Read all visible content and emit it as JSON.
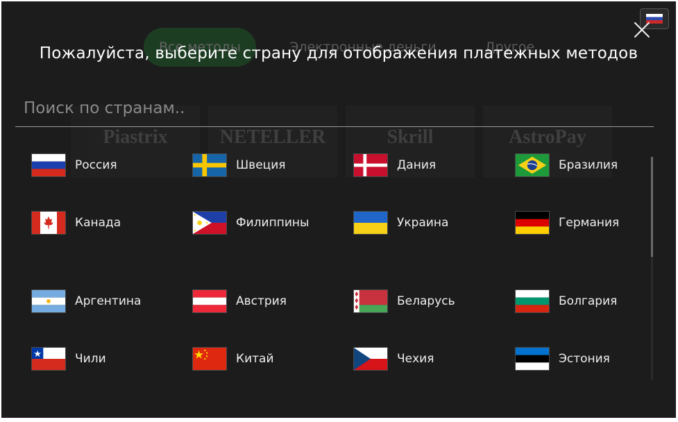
{
  "background": {
    "tabs": [
      {
        "label": "Все методы",
        "active": true
      },
      {
        "label": "Электронные деньги",
        "active": false
      },
      {
        "label": "Другое",
        "active": false
      }
    ],
    "logos": [
      "Piastrix",
      "NETELLER",
      "Skrill",
      "AstroPay"
    ]
  },
  "modal": {
    "title": "Пожалуйста, выберите страну для отображения платежных методов",
    "search_placeholder": "Поиск по странам..",
    "countries": [
      {
        "name": "Россия",
        "flag": "ru"
      },
      {
        "name": "Швеция",
        "flag": "se"
      },
      {
        "name": "Дания",
        "flag": "dk"
      },
      {
        "name": "Бразилия",
        "flag": "br"
      },
      {
        "name": "Канада",
        "flag": "ca"
      },
      {
        "name": "Филиппины",
        "flag": "ph"
      },
      {
        "name": "Украина",
        "flag": "ua"
      },
      {
        "name": "Германия",
        "flag": "de"
      },
      {
        "name": "Аргентина",
        "flag": "ar"
      },
      {
        "name": "Австрия",
        "flag": "at"
      },
      {
        "name": "Беларусь",
        "flag": "by"
      },
      {
        "name": "Болгария",
        "flag": "bg"
      },
      {
        "name": "Чили",
        "flag": "cl"
      },
      {
        "name": "Китай",
        "flag": "cn"
      },
      {
        "name": "Чехия",
        "flag": "cz"
      },
      {
        "name": "Эстония",
        "flag": "ee"
      }
    ]
  },
  "colors": {
    "modal_bg": "#1c1c1c",
    "text": "#eeeeee",
    "accent_green": "#1f7a30"
  }
}
